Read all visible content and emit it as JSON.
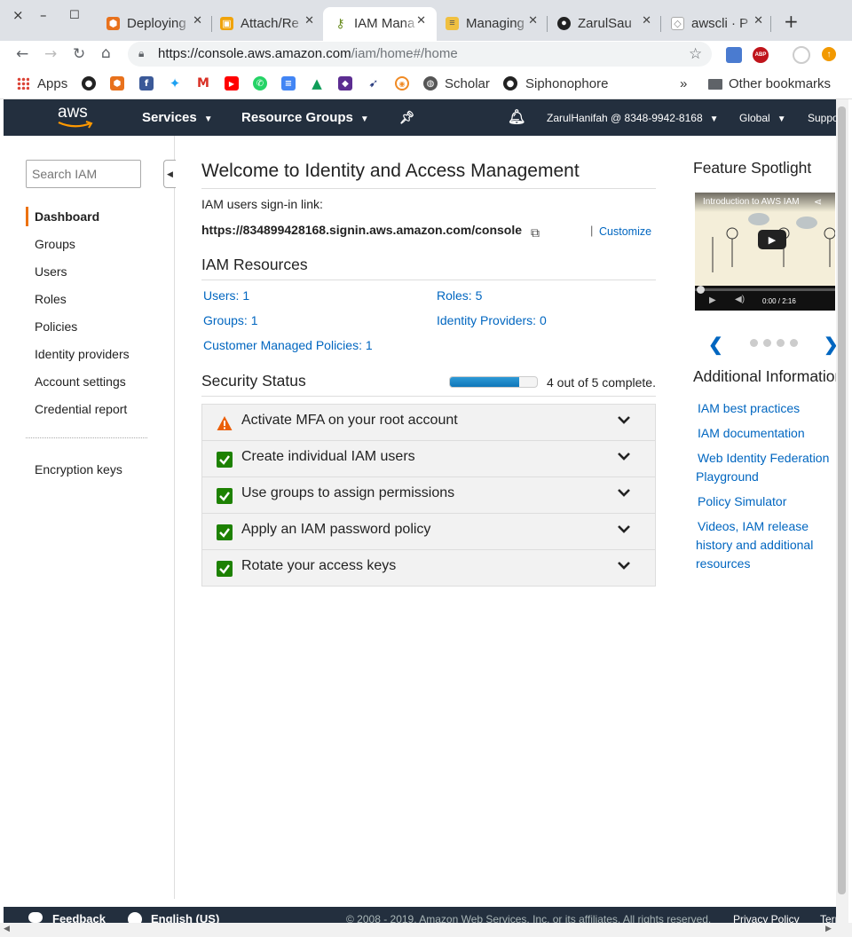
{
  "browser": {
    "window_controls": [
      "×",
      "–",
      "☐"
    ],
    "tabs": [
      {
        "title": "Deploying",
        "favicon": "box-orange-icon",
        "active": false
      },
      {
        "title": "Attach/Re",
        "favicon": "box-yellow-icon",
        "active": false
      },
      {
        "title": "IAM Mana",
        "favicon": "key-icon",
        "active": true
      },
      {
        "title": "Managing",
        "favicon": "doc-icon",
        "active": false
      },
      {
        "title": "ZarulSau",
        "favicon": "github-icon",
        "active": false
      },
      {
        "title": "awscli · P",
        "favicon": "package-icon",
        "active": false
      }
    ],
    "new_tab": "+",
    "url_main": "https://console.aws.amazon.com",
    "url_path": "/iam/home#/home",
    "bookmarks": {
      "apps": "Apps",
      "scholar": "Scholar",
      "siphonophore": "Siphonophore",
      "overflow": "»",
      "other": "Other bookmarks"
    }
  },
  "aws_nav": {
    "logo": "aws",
    "services": "Services",
    "resource_groups": "Resource Groups",
    "account": "ZarulHanifah @ 8348-9942-8168",
    "region": "Global",
    "support": "Support"
  },
  "sidebar": {
    "search_placeholder": "Search IAM",
    "items": [
      "Dashboard",
      "Groups",
      "Users",
      "Roles",
      "Policies",
      "Identity providers",
      "Account settings",
      "Credential report"
    ],
    "active": "Dashboard",
    "extra": "Encryption keys"
  },
  "main": {
    "title": "Welcome to Identity and Access Management",
    "signin_label": "IAM users sign-in link:",
    "signin_url": "https://834899428168.signin.aws.amazon.com/console",
    "customize": "Customize",
    "resources_title": "IAM Resources",
    "resources": {
      "users": "Users: 1",
      "roles": "Roles: 5",
      "groups": "Groups: 1",
      "identity_providers": "Identity Providers: 0",
      "customer_policies": "Customer Managed Policies: 1"
    },
    "security_title": "Security Status",
    "security_progress": 0.8,
    "security_summary": "4 out of 5 complete.",
    "security_items": [
      {
        "label": "Activate MFA on your root account",
        "status": "warning"
      },
      {
        "label": "Create individual IAM users",
        "status": "complete"
      },
      {
        "label": "Use groups to assign permissions",
        "status": "complete"
      },
      {
        "label": "Apply an IAM password policy",
        "status": "complete"
      },
      {
        "label": "Rotate your access keys",
        "status": "complete"
      }
    ]
  },
  "right": {
    "spotlight_title": "Feature Spotlight",
    "video_title": "Introduction to AWS IAM",
    "video_time": "0:00 / 2:16",
    "additional_title": "Additional Information",
    "links": [
      "IAM best practices",
      "IAM documentation",
      "Web Identity Federation Playground",
      "Policy Simulator",
      "Videos, IAM release history and additional resources"
    ]
  },
  "footer": {
    "feedback": "Feedback",
    "language": "English (US)",
    "copyright": "© 2008 - 2019, Amazon Web Services, Inc. or its affiliates. All rights reserved.",
    "privacy": "Privacy Policy",
    "terms": "Terms of Use"
  },
  "colors": {
    "aws_nav": "#232f3e",
    "link": "#0066c0",
    "accent": "#ec7211",
    "success": "#1d8102",
    "warning": "#eb5f07"
  }
}
